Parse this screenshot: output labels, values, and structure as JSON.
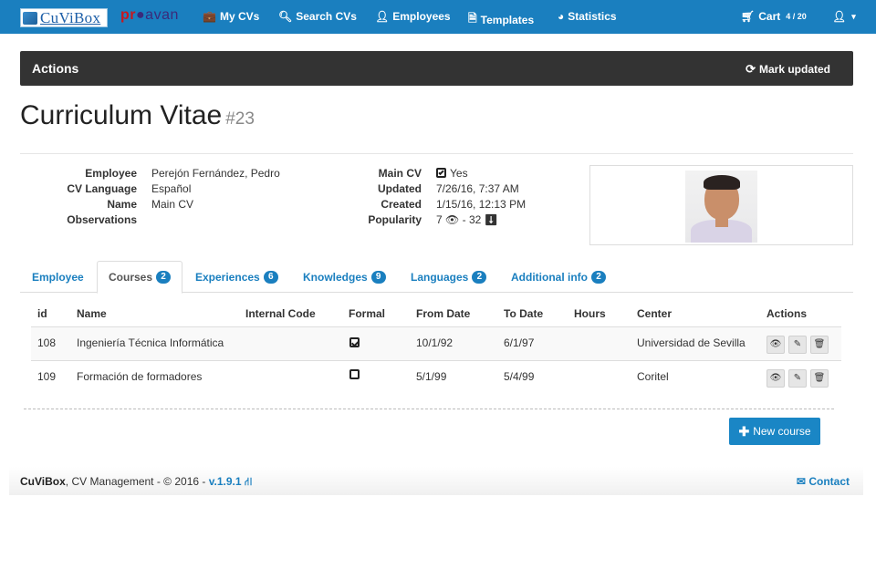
{
  "navbar": {
    "brand": "CuViBox",
    "partner": "proavan",
    "items": [
      {
        "label": "My CVs",
        "icon": "briefcase-icon"
      },
      {
        "label": "Search CVs",
        "icon": "search-icon"
      },
      {
        "label": "Employees",
        "icon": "user-icon"
      },
      {
        "label": "Templates",
        "icon": "file-icon"
      },
      {
        "label": "Statistics",
        "icon": "pie-chart-icon"
      }
    ],
    "cart_label": "Cart",
    "cart_count": "4 / 20",
    "user_icon": "user-menu-icon"
  },
  "actions": {
    "title": "Actions",
    "mark_updated": "Mark updated"
  },
  "page": {
    "title": "Curriculum Vitae",
    "number": "#23"
  },
  "info": {
    "employee_label": "Employee",
    "employee_value": "Perejón Fernández, Pedro",
    "language_label": "CV Language",
    "language_value": "Español",
    "name_label": "Name",
    "name_value": "Main CV",
    "observations_label": "Observations",
    "main_cv_label": "Main CV",
    "main_cv_value": "Yes",
    "updated_label": "Updated",
    "updated_value": "7/26/16, 7:37 AM",
    "created_label": "Created",
    "created_value": "1/15/16, 12:13 PM",
    "popularity_label": "Popularity",
    "popularity_views": "7",
    "popularity_sep": "-",
    "popularity_downloads": "32"
  },
  "tabs": [
    {
      "label": "Employee",
      "badge": ""
    },
    {
      "label": "Courses",
      "badge": "2"
    },
    {
      "label": "Experiences",
      "badge": "6"
    },
    {
      "label": "Knowledges",
      "badge": "9"
    },
    {
      "label": "Languages",
      "badge": "2"
    },
    {
      "label": "Additional info",
      "badge": "2"
    }
  ],
  "table": {
    "headers": [
      "id",
      "Name",
      "Internal Code",
      "Formal",
      "From Date",
      "To Date",
      "Hours",
      "Center",
      "Actions"
    ],
    "rows": [
      {
        "id": "108",
        "name": "Ingeniería Técnica Informática",
        "internal_code": "",
        "formal": true,
        "from": "10/1/92",
        "to": "6/1/97",
        "hours": "",
        "center": "Universidad de Sevilla"
      },
      {
        "id": "109",
        "name": "Formación de formadores",
        "internal_code": "",
        "formal": false,
        "from": "5/1/99",
        "to": "5/4/99",
        "hours": "",
        "center": "Coritel"
      }
    ]
  },
  "new_course": "New course",
  "footer": {
    "brand": "CuViBox",
    "text": ", CV Management - © 2016 - ",
    "version": "v.1.9.1",
    "contact": "Contact"
  }
}
